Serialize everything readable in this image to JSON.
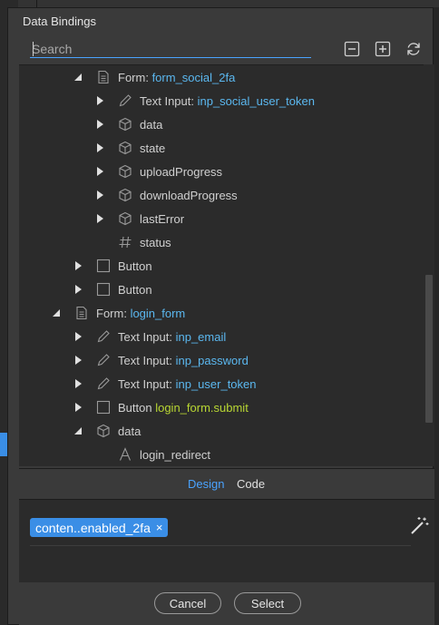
{
  "window": {
    "title": "Data Bindings"
  },
  "search": {
    "placeholder": "Search",
    "value": ""
  },
  "toolbar": {
    "collapse_icon": "collapse-all-icon",
    "expand_icon": "expand-all-icon",
    "refresh_icon": "refresh-icon"
  },
  "tree": [
    {
      "expanded": true,
      "icon": "document-icon",
      "prefix": "Form: ",
      "name": "form_social_2fa",
      "name_color": "blue"
    },
    {
      "expanded": false,
      "icon": "pencil-icon",
      "prefix": "Text Input: ",
      "name": "inp_social_user_token",
      "name_color": "blue"
    },
    {
      "expanded": false,
      "icon": "cube-icon",
      "prefix": "data",
      "name": ""
    },
    {
      "expanded": false,
      "icon": "cube-icon",
      "prefix": "state",
      "name": ""
    },
    {
      "expanded": false,
      "icon": "cube-icon",
      "prefix": "uploadProgress",
      "name": ""
    },
    {
      "expanded": false,
      "icon": "cube-icon",
      "prefix": "downloadProgress",
      "name": ""
    },
    {
      "expanded": false,
      "icon": "cube-icon",
      "prefix": "lastError",
      "name": ""
    },
    {
      "expanded": null,
      "icon": "hash-icon",
      "prefix": "status",
      "name": ""
    },
    {
      "expanded": false,
      "icon": "square-icon",
      "prefix": "Button",
      "name": ""
    },
    {
      "expanded": false,
      "icon": "square-icon",
      "prefix": "Button",
      "name": ""
    },
    {
      "expanded": true,
      "icon": "document-icon",
      "prefix": "Form: ",
      "name": "login_form",
      "name_color": "blue"
    },
    {
      "expanded": false,
      "icon": "pencil-icon",
      "prefix": "Text Input: ",
      "name": "inp_email",
      "name_color": "blue"
    },
    {
      "expanded": false,
      "icon": "pencil-icon",
      "prefix": "Text Input: ",
      "name": "inp_password",
      "name_color": "blue"
    },
    {
      "expanded": false,
      "icon": "pencil-icon",
      "prefix": "Text Input: ",
      "name": "inp_user_token",
      "name_color": "blue"
    },
    {
      "expanded": false,
      "icon": "square-icon",
      "prefix": "Button ",
      "name": "login_form.submit",
      "name_color": "green"
    },
    {
      "expanded": true,
      "icon": "cube-icon",
      "prefix": "data",
      "name": ""
    },
    {
      "expanded": null,
      "icon": "letter-a-icon",
      "prefix": "login_redirect",
      "name": ""
    }
  ],
  "tabs": {
    "design": "Design",
    "code": "Code",
    "active": "design"
  },
  "binding": {
    "chip_text": "conten..enabled_2fa",
    "chip_remove": "×"
  },
  "footer": {
    "cancel": "Cancel",
    "select": "Select"
  },
  "colors": {
    "accent": "#3a8ee6",
    "link_blue": "#5bb8f0",
    "link_green": "#b8d633",
    "panel_bg": "#2b2b2b",
    "dialog_bg": "#3a3a3a"
  }
}
